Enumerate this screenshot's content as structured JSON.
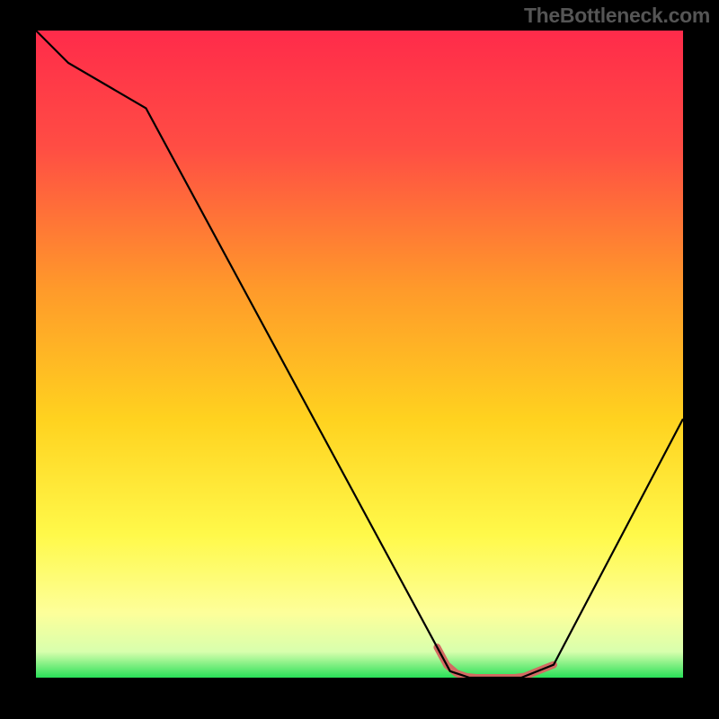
{
  "watermark": "TheBottleneck.com",
  "chart_data": {
    "type": "line",
    "title": "",
    "xlabel": "",
    "ylabel": "",
    "xlim": [
      0,
      100
    ],
    "ylim": [
      0,
      100
    ],
    "series": [
      {
        "name": "curve",
        "x": [
          0,
          5,
          17,
          64,
          67,
          75,
          80,
          100
        ],
        "values": [
          100,
          95,
          88,
          1,
          0,
          0,
          2,
          40
        ]
      }
    ],
    "accent_range_x": [
      62,
      80
    ],
    "gradient_stops": [
      {
        "offset": 0.0,
        "color": "#ff2b4a"
      },
      {
        "offset": 0.18,
        "color": "#ff4d44"
      },
      {
        "offset": 0.4,
        "color": "#ff9a2a"
      },
      {
        "offset": 0.6,
        "color": "#ffd21f"
      },
      {
        "offset": 0.78,
        "color": "#fff94a"
      },
      {
        "offset": 0.9,
        "color": "#fdff9a"
      },
      {
        "offset": 0.96,
        "color": "#d8ffad"
      },
      {
        "offset": 1.0,
        "color": "#29e058"
      }
    ]
  }
}
